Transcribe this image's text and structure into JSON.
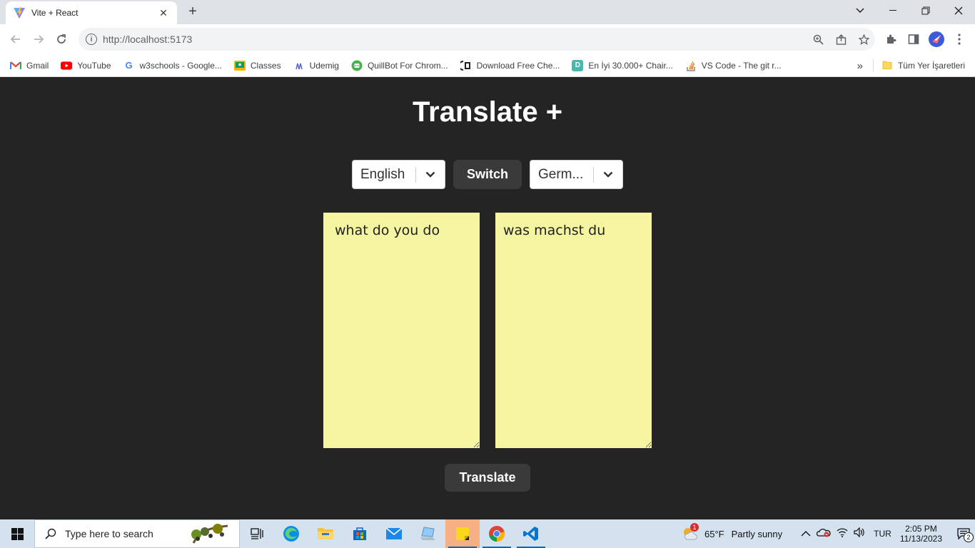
{
  "browser": {
    "tab_title": "Vite + React",
    "url": "http://localhost:5173",
    "bookmarks": [
      {
        "label": "Gmail",
        "icon": "gmail-icon"
      },
      {
        "label": "YouTube",
        "icon": "youtube-icon"
      },
      {
        "label": "w3schools - Google...",
        "icon": "google-icon"
      },
      {
        "label": "Classes",
        "icon": "classroom-icon"
      },
      {
        "label": "Udemig",
        "icon": "udemy-icon"
      },
      {
        "label": "QuillBot For Chrom...",
        "icon": "quillbot-icon"
      },
      {
        "label": "Download Free Che...",
        "icon": "chegg-icon"
      },
      {
        "label": "En İyi 30.000+ Chair...",
        "icon": "d-icon"
      },
      {
        "label": "VS Code - The git r...",
        "icon": "stackoverflow-icon"
      }
    ],
    "bookmarks_more": "»",
    "bookmarks_folder": "Tüm Yer İşaretleri"
  },
  "app": {
    "title": "Translate +",
    "from_language": "English",
    "to_language": "Germ...",
    "switch_label": "Switch",
    "input_text": "what do you do",
    "output_text": "was machst du",
    "translate_label": "Translate"
  },
  "taskbar": {
    "search_placeholder": "Type here to search",
    "weather_temp": "65°F",
    "weather_desc": "Partly sunny",
    "weather_badge": "1",
    "language": "TUR",
    "time": "2:05 PM",
    "date": "11/13/2023",
    "notification_count": "2"
  }
}
